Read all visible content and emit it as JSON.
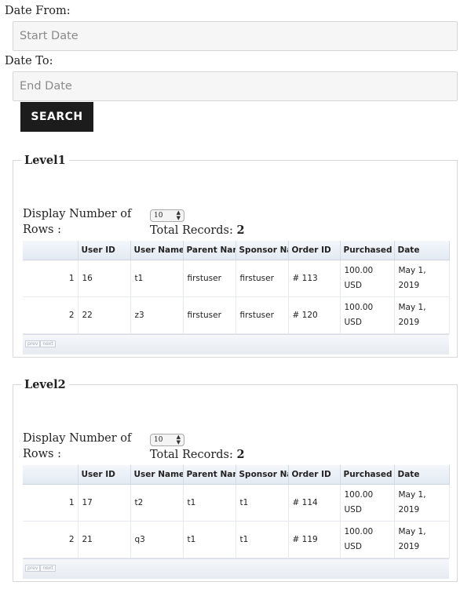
{
  "form": {
    "date_from_label": "Date From:",
    "date_from_placeholder": "Start Date",
    "date_to_label": "Date To:",
    "date_to_placeholder": "End Date",
    "search_label": "SEARCH"
  },
  "levels": [
    {
      "title": "Level1",
      "display_label_1": "Display Number of",
      "display_label_2": "Rows :",
      "rows_select_value": "10",
      "total_label": "Total Records:",
      "total_value": "2",
      "columns": [
        "",
        "User ID",
        "User Name",
        "Parent Nan",
        "Sponsor Na",
        "Order ID",
        "Purchased",
        "Date"
      ],
      "rows": [
        {
          "index": "1",
          "user_id": "16",
          "user_name": "t1",
          "parent": "firstuser",
          "sponsor": "firstuser",
          "order_id": "# 113",
          "purchased_1": "100.00",
          "purchased_2": "USD",
          "date_1": "May 1,",
          "date_2": "2019"
        },
        {
          "index": "2",
          "user_id": "22",
          "user_name": "z3",
          "parent": "firstuser",
          "sponsor": "firstuser",
          "order_id": "# 120",
          "purchased_1": "100.00",
          "purchased_2": "USD",
          "date_1": "May 1,",
          "date_2": "2019"
        }
      ],
      "pager": {
        "prev": "prev",
        "next": "next"
      }
    },
    {
      "title": "Level2",
      "display_label_1": "Display Number of",
      "display_label_2": "Rows :",
      "rows_select_value": "10",
      "total_label": "Total Records:",
      "total_value": "2",
      "columns": [
        "",
        "User ID",
        "User Name",
        "Parent Nan",
        "Sponsor Na",
        "Order ID",
        "Purchased",
        "Date"
      ],
      "rows": [
        {
          "index": "1",
          "user_id": "17",
          "user_name": "t2",
          "parent": "t1",
          "sponsor": "t1",
          "order_id": "# 114",
          "purchased_1": "100.00",
          "purchased_2": "USD",
          "date_1": "May 1,",
          "date_2": "2019"
        },
        {
          "index": "2",
          "user_id": "21",
          "user_name": "q3",
          "parent": "t1",
          "sponsor": "t1",
          "order_id": "# 119",
          "purchased_1": "100.00",
          "purchased_2": "USD",
          "date_1": "May 1,",
          "date_2": "2019"
        }
      ],
      "pager": {
        "prev": "prev",
        "next": "next"
      }
    }
  ]
}
